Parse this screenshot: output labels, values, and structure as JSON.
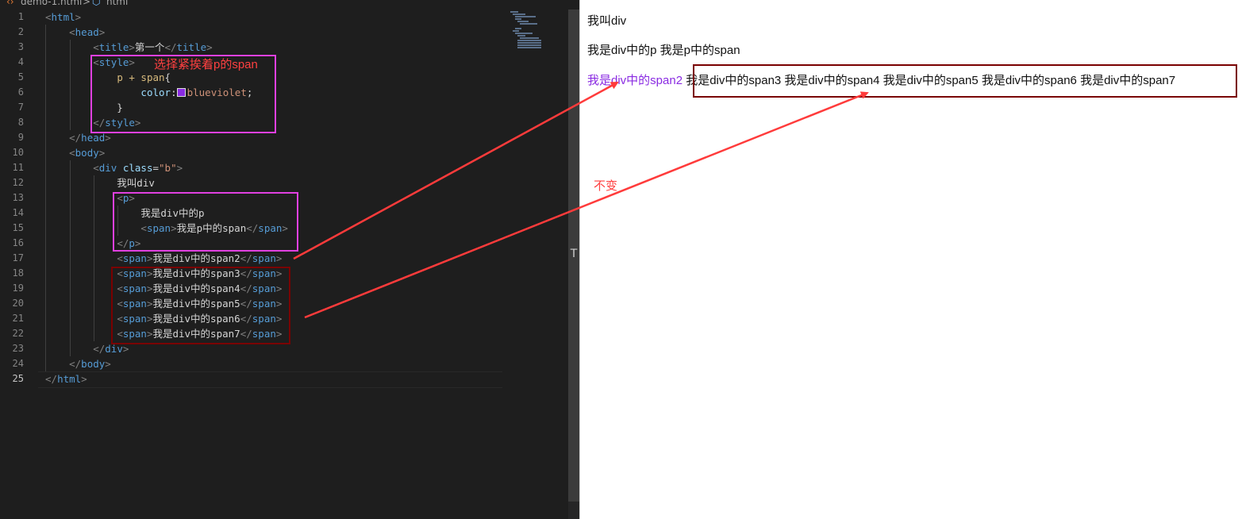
{
  "editor": {
    "breadcrumb": {
      "file": "demo-1.html",
      "separator": ">",
      "node": "html"
    },
    "lines": [
      {
        "n": "1",
        "html": "<span class='pn'>&lt;</span><span class='tg'>html</span><span class='pn'>&gt;</span>"
      },
      {
        "n": "2",
        "html": "    <span class='pn'>&lt;</span><span class='tg'>head</span><span class='pn'>&gt;</span>"
      },
      {
        "n": "3",
        "html": "        <span class='pn'>&lt;</span><span class='tg'>title</span><span class='pn'>&gt;</span>第一个<span class='pn'>&lt;/</span><span class='tg'>title</span><span class='pn'>&gt;</span>"
      },
      {
        "n": "4",
        "html": "        <span class='pn'>&lt;</span><span class='tg'>style</span><span class='pn'>&gt;</span>"
      },
      {
        "n": "5",
        "html": "            <span class='sel'>p + span</span>{"
      },
      {
        "n": "6",
        "html": "                <span class='pr'>color</span>:<span class='swatch'></span><span class='vl'>blueviolet</span>;"
      },
      {
        "n": "7",
        "html": "            }"
      },
      {
        "n": "8",
        "html": "        <span class='pn'>&lt;/</span><span class='tg'>style</span><span class='pn'>&gt;</span>"
      },
      {
        "n": "9",
        "html": "    <span class='pn'>&lt;/</span><span class='tg'>head</span><span class='pn'>&gt;</span>"
      },
      {
        "n": "10",
        "html": "    <span class='pn'>&lt;</span><span class='tg'>body</span><span class='pn'>&gt;</span>"
      },
      {
        "n": "11",
        "html": "        <span class='pn'>&lt;</span><span class='tg'>div</span> <span class='at'>class</span>=<span class='st'>\"b\"</span><span class='pn'>&gt;</span>"
      },
      {
        "n": "12",
        "html": "            我叫div"
      },
      {
        "n": "13",
        "html": "            <span class='pn'>&lt;</span><span class='tg'>p</span><span class='pn'>&gt;</span>"
      },
      {
        "n": "14",
        "html": "                我是div中的p"
      },
      {
        "n": "15",
        "html": "                <span class='pn'>&lt;</span><span class='tg'>span</span><span class='pn'>&gt;</span>我是p中的span<span class='pn'>&lt;/</span><span class='tg'>span</span><span class='pn'>&gt;</span>"
      },
      {
        "n": "16",
        "html": "            <span class='pn'>&lt;/</span><span class='tg'>p</span><span class='pn'>&gt;</span>"
      },
      {
        "n": "17",
        "html": "            <span class='pn'>&lt;</span><span class='tg'>span</span><span class='pn'>&gt;</span>我是div中的span2<span class='pn'>&lt;/</span><span class='tg'>span</span><span class='pn'>&gt;</span>"
      },
      {
        "n": "18",
        "html": "            <span class='pn'>&lt;</span><span class='tg'>span</span><span class='pn'>&gt;</span>我是div中的span3<span class='pn'>&lt;/</span><span class='tg'>span</span><span class='pn'>&gt;</span>"
      },
      {
        "n": "19",
        "html": "            <span class='pn'>&lt;</span><span class='tg'>span</span><span class='pn'>&gt;</span>我是div中的span4<span class='pn'>&lt;/</span><span class='tg'>span</span><span class='pn'>&gt;</span>"
      },
      {
        "n": "20",
        "html": "            <span class='pn'>&lt;</span><span class='tg'>span</span><span class='pn'>&gt;</span>我是div中的span5<span class='pn'>&lt;/</span><span class='tg'>span</span><span class='pn'>&gt;</span>"
      },
      {
        "n": "21",
        "html": "            <span class='pn'>&lt;</span><span class='tg'>span</span><span class='pn'>&gt;</span>我是div中的span6<span class='pn'>&lt;/</span><span class='tg'>span</span><span class='pn'>&gt;</span>"
      },
      {
        "n": "22",
        "html": "            <span class='pn'>&lt;</span><span class='tg'>span</span><span class='pn'>&gt;</span>我是div中的span7<span class='pn'>&lt;/</span><span class='tg'>span</span><span class='pn'>&gt;</span>"
      },
      {
        "n": "23",
        "html": "        <span class='pn'>&lt;/</span><span class='tg'>div</span><span class='pn'>&gt;</span>"
      },
      {
        "n": "24",
        "html": "    <span class='pn'>&lt;/</span><span class='tg'>body</span><span class='pn'>&gt;</span>"
      },
      {
        "n": "25",
        "html": "<span class='pn'>&lt;/</span><span class='tg'>html</span><span class='pn'>&gt;</span>"
      }
    ],
    "annotation": "选择紧挨着p的span",
    "scroll_glyph": "T"
  },
  "browser": {
    "line1": "我叫div",
    "line2": "我是div中的p 我是p中的span",
    "span2": "我是div中的span2",
    "rest": "我是div中的span3 我是div中的span4 我是div中的span5 我是div中的span6 我是div中的span7",
    "annotation": "不变"
  },
  "colors": {
    "highlight_box": "#e040e0",
    "dark_box": "#7a0000",
    "arrow": "#ff3b3b",
    "blueviolet": "#8a2be2"
  }
}
